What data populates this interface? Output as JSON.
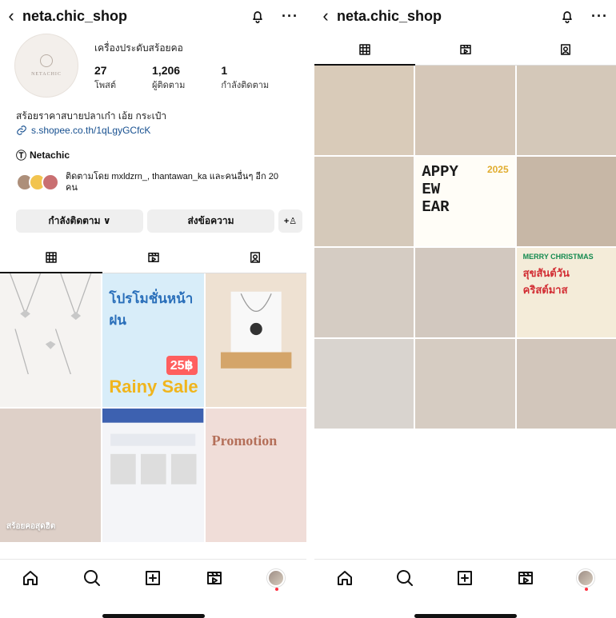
{
  "left_screen": {
    "header": {
      "username": "neta.chic_shop",
      "back_icon": "‹",
      "bell_icon": "bell-icon",
      "more_icon": "more-icon",
      "more_label": "···"
    },
    "profile": {
      "display_name": "เครื่องประดับสร้อยคอ",
      "logo_text": "NETACHIC",
      "posts_value": "27",
      "posts_label": "โพสต์",
      "followers_value": "1,206",
      "followers_label": "ผู้ติดตาม",
      "following_value": "1",
      "following_label": "กำลังติดตาม",
      "bio": "สร้อยราคาสบายปลาเก๋า เอ้ย กระเป๋า",
      "link": "s.shopee.co.th/1qLgyGCfcK",
      "threads": "Netachic",
      "followed_by": "ติดตามโดย mxldzrn_, thantawan_ka และคนอื่นๆ อีก 20 คน"
    },
    "buttons": {
      "following": "กำลังติดตาม ∨",
      "message": "ส่งข้อความ",
      "add_friend": "+ผู้ใช้"
    },
    "tiles": {
      "promo_headline": "โปรโมชั่นหน้าฝน",
      "promo_sub": "Rainy Sale",
      "promo_price": "25฿",
      "collage_label": "สร้อยคอสุดฮิต",
      "promotion_label": "Promotion"
    }
  },
  "right_screen": {
    "header": {
      "username": "neta.chic_shop",
      "back_icon": "‹",
      "bell_icon": "bell-icon",
      "more_icon": "more-icon",
      "more_label": "···"
    },
    "tiles": {
      "newyear_headline": "APPY\nEW\nEAR",
      "newyear_year": "2025",
      "christmas_title": "MERRY CHRISTMAS",
      "christmas_thai": "สุขสันต์วันคริสต์มาส"
    }
  },
  "colors": {
    "link": "#164f8f",
    "notification_dot": "#ff3040",
    "tile_blue": "#2a6fba",
    "tile_red": "#ff5f5f",
    "tile_yellow": "#f0b51d"
  },
  "icons": {
    "grid": "grid-icon",
    "reels": "reels-icon",
    "tagged": "tagged-icon",
    "home": "home-icon",
    "search": "search-icon",
    "create": "create-icon",
    "profile": "profile-icon"
  }
}
